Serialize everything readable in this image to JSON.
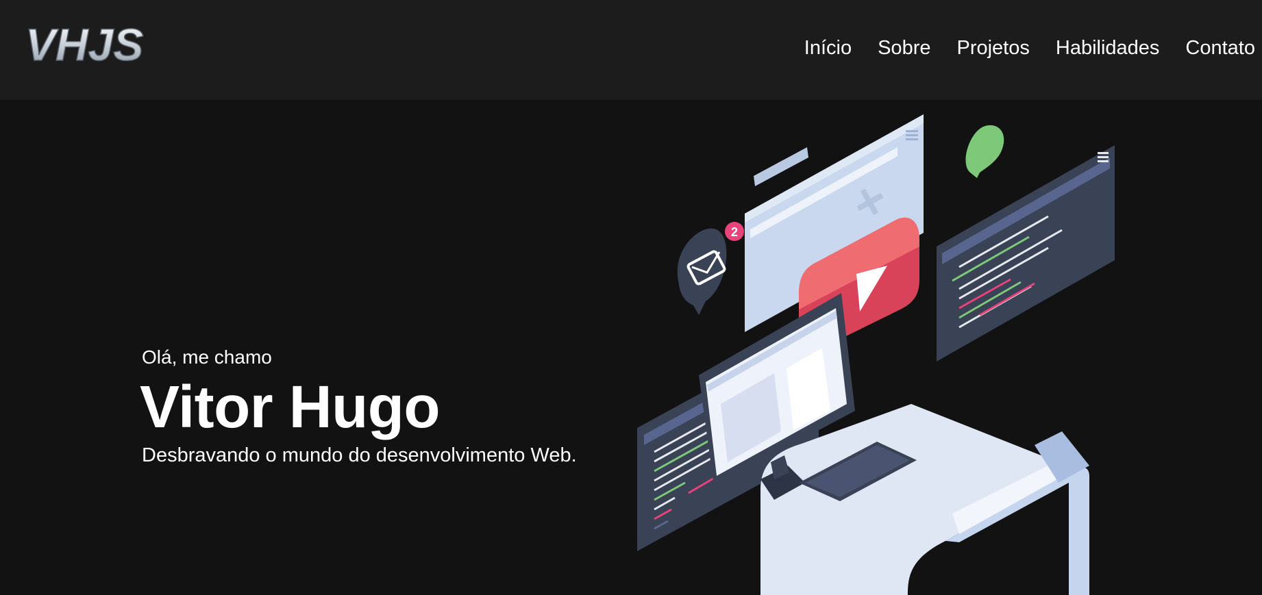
{
  "header": {
    "logo_text": "VHJS",
    "nav": [
      {
        "label": "Início"
      },
      {
        "label": "Sobre"
      },
      {
        "label": "Projetos"
      },
      {
        "label": "Habilidades"
      },
      {
        "label": "Contato"
      }
    ]
  },
  "hero": {
    "greeting": "Olá, me chamo",
    "name": "Vitor Hugo",
    "tagline": "Desbravando o mundo do desenvolvimento Web."
  },
  "illustration": {
    "mail_badge_count": "2",
    "colors": {
      "background": "#121212",
      "header": "#1c1c1c",
      "play_red": "#e04a5c",
      "accent_green": "#7ec87a",
      "badge_pink": "#e8437a",
      "panel_dark": "#3a4256",
      "panel_light": "#cfdcef"
    }
  }
}
